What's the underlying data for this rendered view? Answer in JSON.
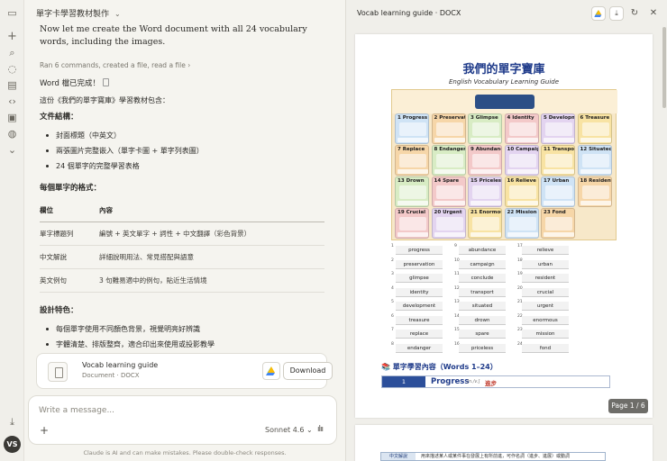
{
  "chat": {
    "title": "單字卡學習教材製作",
    "intro": "Now let me create the Word document with all 24 vocabulary words, including the images.",
    "ran": "Ran 6 commands, created a file, read a file  ›",
    "done": "Word 檔已完成！",
    "summary": "這份《我們的單字寶庫》學習教材包含：",
    "structure_heading": "文件結構：",
    "structure_items": [
      "封面標題（中英文）",
      "兩張圖片完整嵌入（單字卡圖 + 單字列表圖）",
      "24 個單字的完整學習表格"
    ],
    "format_heading": "每個單字的格式：",
    "format_table": {
      "headers": [
        "欄位",
        "內容"
      ],
      "rows": [
        [
          "單字標題列",
          "編號 + 英文單字 + 詞性 + 中文翻譯（彩色背景）"
        ],
        [
          "中文解說",
          "詳細說明用法、常見搭配與語意"
        ],
        [
          "英文例句",
          "3 句難易適中的例句，貼近生活情境"
        ]
      ]
    },
    "design_heading": "設計特色：",
    "design_items": [
      "每個單字使用不同顏色背景，視覺明亮好辨識",
      "字體清楚、排版整齊，適合印出來使用或投影教學"
    ],
    "file_card": {
      "name": "Vocab learning guide",
      "meta": "Document · DOCX",
      "download": "Download"
    },
    "composer": {
      "placeholder": "Write a message...",
      "model": "Sonnet 4.6  ⌄"
    },
    "disclaimer": "Claude is AI and can make mistakes. Please double-check responses."
  },
  "user": {
    "initials": "VS"
  },
  "preview": {
    "title": "Vocab learning guide · DOCX",
    "page_badge": "Page 1 / 6",
    "doc_title": "我們的單字寶庫",
    "doc_subtitle": "English Vocabulary Learning Guide",
    "section_heading": "📚 單字學習內容（Words 1–24）",
    "first_entry": {
      "num": "1",
      "word": "Progress",
      "pos": "[n./v.]",
      "zh": "進步"
    },
    "poster_words": [
      "1 Progress",
      "2 Preservation",
      "3 Glimpse",
      "4 Identity",
      "5 Development",
      "6 Treasure",
      "7 Replace",
      "8 Endanger",
      "9 Abundance",
      "10 Campaign",
      "11 Transport",
      "12 Situated",
      "13 Drown",
      "14 Spare",
      "15 Priceless",
      "16 Relieve",
      "17 Urban",
      "18 Resident",
      "19 Crucial",
      "20 Urgent",
      "21 Enormous",
      "22 Mission",
      "23 Fond"
    ],
    "vocab_columns": [
      [
        "progress",
        "preservation",
        "glimpse",
        "identity",
        "development",
        "treasure",
        "replace",
        "endanger"
      ],
      [
        "abundance",
        "campaign",
        "conclude",
        "transport",
        "situated",
        "drown",
        "spare",
        "priceless"
      ],
      [
        "relieve",
        "urban",
        "resident",
        "crucial",
        "urgent",
        "enormous",
        "mission",
        "fond"
      ]
    ],
    "vocab_numbers": [
      [
        "1",
        "2",
        "3",
        "4",
        "5",
        "6",
        "7",
        "8"
      ],
      [
        "9",
        "10",
        "11",
        "12",
        "13",
        "14",
        "15",
        "16"
      ],
      [
        "17",
        "18",
        "19",
        "20",
        "21",
        "22",
        "23",
        "24"
      ]
    ],
    "page2_label": "中文解說",
    "page2_text": "用來描述某人或某件事在發展上有所前進，可作名詞（進步、進展）或動詞"
  },
  "colors": {
    "accent_blue": "#1f3b8a",
    "red": "#c0392b"
  }
}
